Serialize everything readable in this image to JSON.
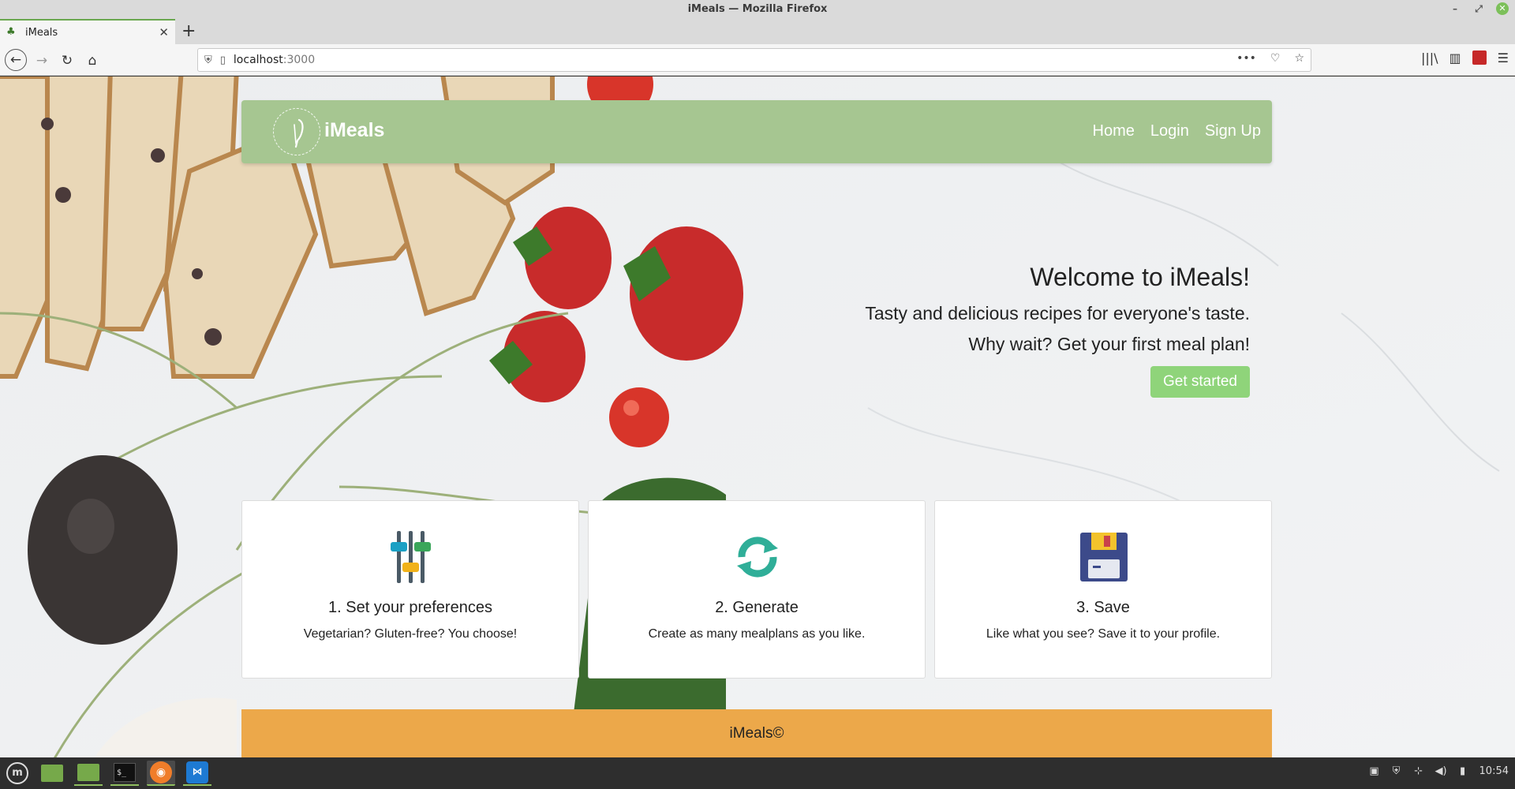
{
  "window": {
    "title": "iMeals — Mozilla Firefox",
    "tab_title": "iMeals",
    "tab_close": "✕",
    "new_tab": "+"
  },
  "toolbar": {
    "back": "←",
    "forward": "→",
    "reload": "↻",
    "home": "⌂",
    "url_host": "localhost",
    "url_port": ":3000",
    "url_more": "•••",
    "library": "|||\\",
    "menu": "☰"
  },
  "site": {
    "brand": "iMeals",
    "nav": [
      "Home",
      "Login",
      "Sign Up"
    ]
  },
  "hero": {
    "title": "Welcome to iMeals!",
    "subtitle": "Tasty and delicious recipes for everyone's taste.",
    "subtitle2": "Why wait? Get your first meal plan!",
    "cta": "Get started"
  },
  "cards": [
    {
      "title": "1. Set your preferences",
      "text": "Vegetarian? Gluten-free? You choose!",
      "icon": "sliders-icon"
    },
    {
      "title": "2. Generate",
      "text": "Create as many mealplans as you like.",
      "icon": "refresh-icon"
    },
    {
      "title": "3. Save",
      "text": "Like what you see? Save it to your profile.",
      "icon": "save-icon"
    }
  ],
  "footer": {
    "text": "iMeals©"
  },
  "taskbar": {
    "clock": "10:54",
    "menu_glyph": "m",
    "terminal_glyph": "$_"
  },
  "colors": {
    "nav_green": "#a6c691",
    "cta_green": "#8fd47a",
    "footer_orange": "#eca84a"
  }
}
